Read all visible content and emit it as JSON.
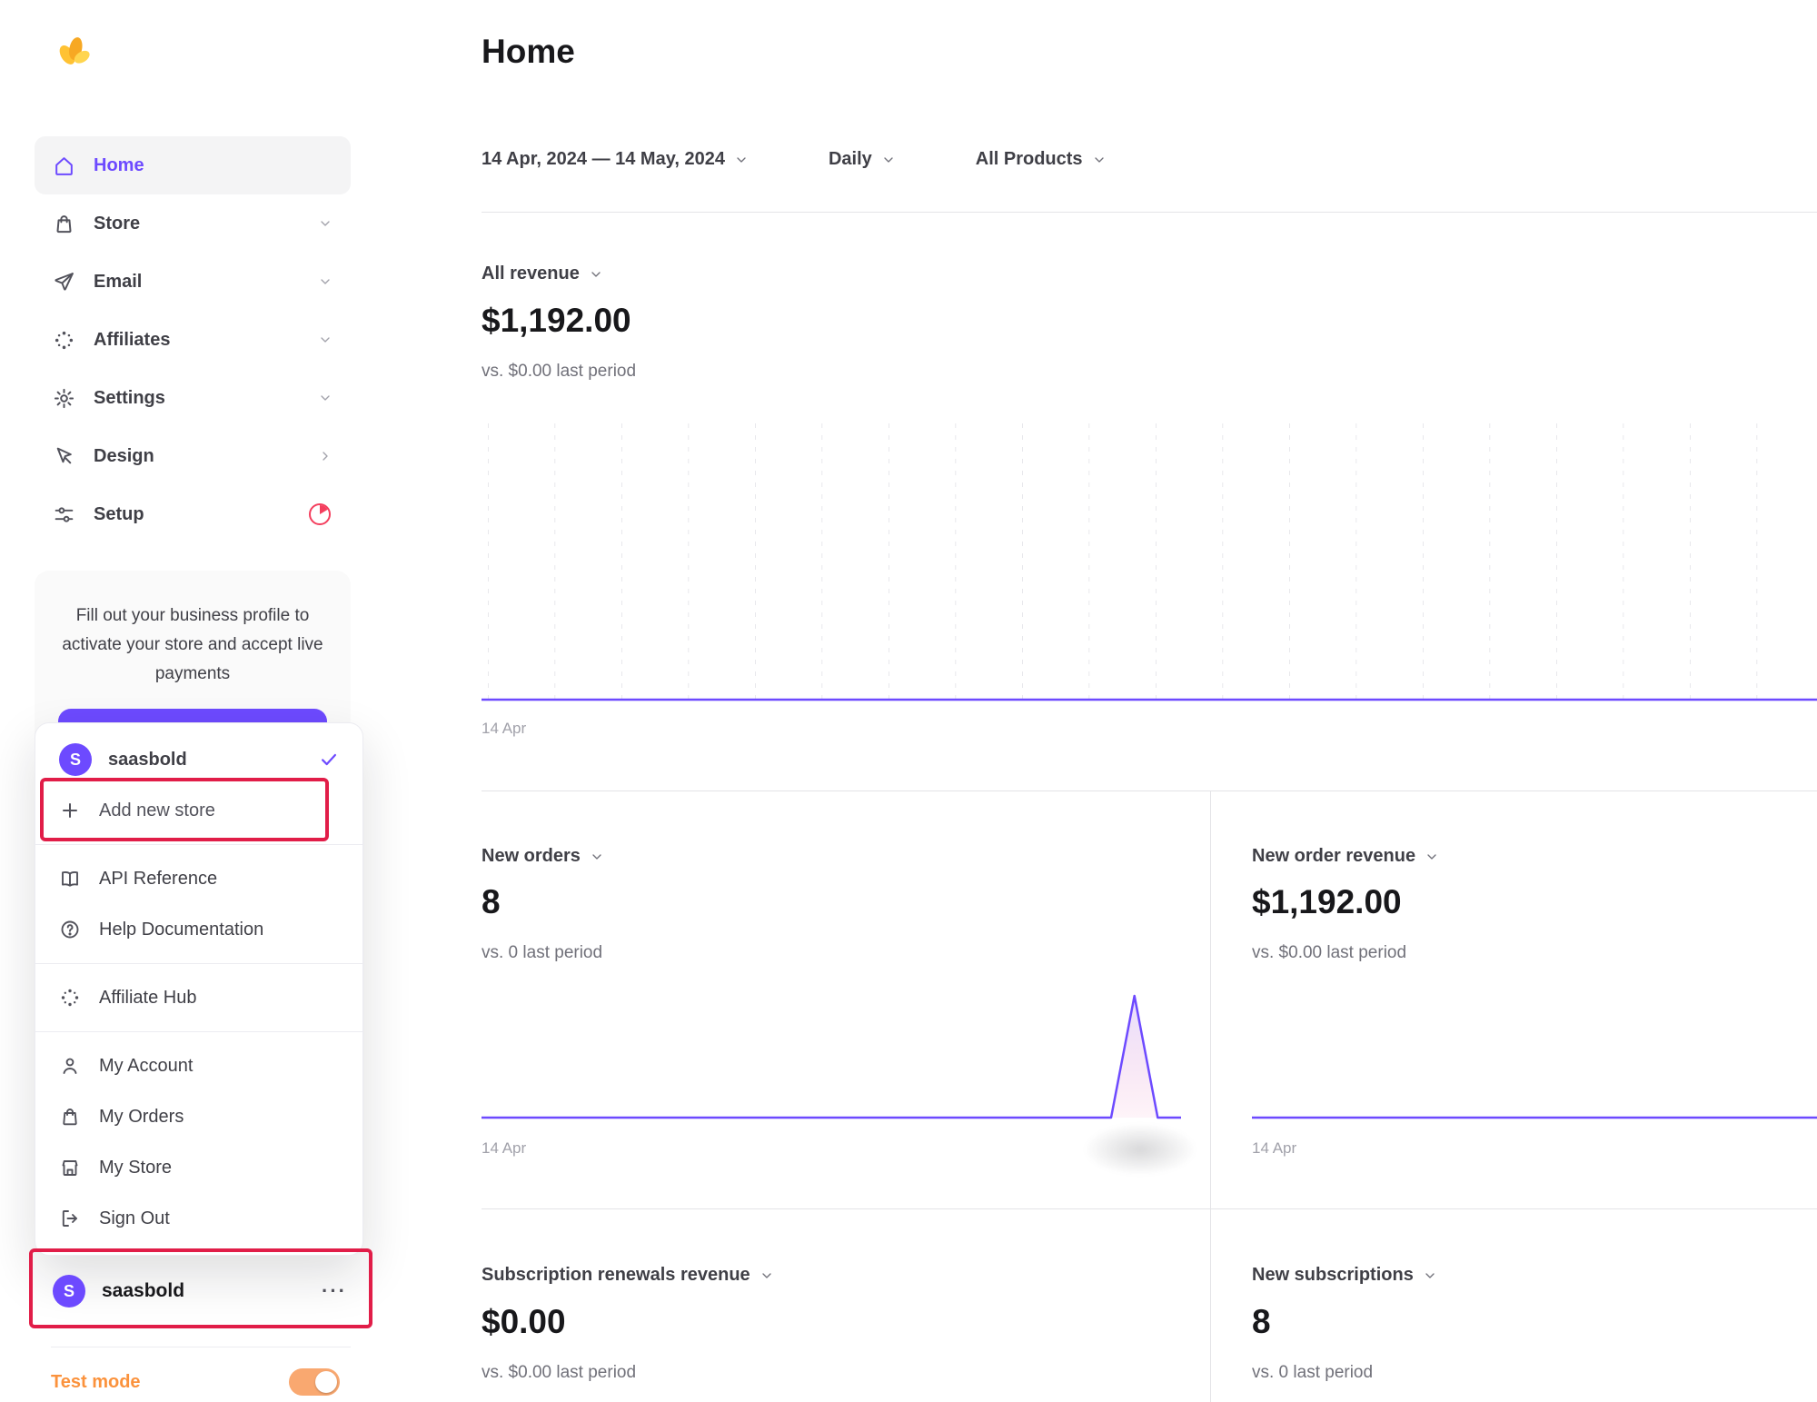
{
  "colors": {
    "accent": "#6d4aff",
    "annotation": "#e11d48",
    "test_mode_orange": "#fb923c",
    "logo_yellow": "#ffc233",
    "setup_badge_pink": "#f43f5e",
    "chart_line": "#6d4aff",
    "grid_line": "#dfdfe3"
  },
  "sidebar": {
    "nav": [
      {
        "label": "Home",
        "icon": "home-icon",
        "active": true
      },
      {
        "label": "Store",
        "icon": "store-bag-icon",
        "chevron": "down"
      },
      {
        "label": "Email",
        "icon": "send-icon",
        "chevron": "down"
      },
      {
        "label": "Affiliates",
        "icon": "affiliates-dots-icon",
        "chevron": "down"
      },
      {
        "label": "Settings",
        "icon": "gear-icon",
        "chevron": "down"
      },
      {
        "label": "Design",
        "icon": "cursor-icon",
        "chevron": "right"
      },
      {
        "label": "Setup",
        "icon": "sliders-icon",
        "badge": "pie-progress-icon"
      }
    ],
    "business_card": {
      "text": "Fill out your business profile to activate your store and accept live payments"
    },
    "store_row": {
      "name": "saasbold",
      "avatar_letter": "S",
      "more": "···"
    },
    "test_mode_label": "Test mode",
    "test_mode_on": true
  },
  "popover": {
    "store_name": "saasbold",
    "avatar_letter": "S",
    "items": {
      "add_new_store": "Add new store",
      "api_reference": "API Reference",
      "help_documentation": "Help Documentation",
      "affiliate_hub": "Affiliate Hub",
      "my_account": "My Account",
      "my_orders": "My Orders",
      "my_store": "My Store",
      "sign_out": "Sign Out"
    }
  },
  "main": {
    "title": "Home",
    "filters": {
      "date_range": "14 Apr, 2024 — 14 May, 2024",
      "granularity": "Daily",
      "products": "All Products"
    },
    "cards": {
      "all_revenue": {
        "label": "All revenue",
        "value": "$1,192.00",
        "comparison": "vs. $0.00 last period",
        "x_label": "14 Apr"
      },
      "new_orders": {
        "label": "New orders",
        "value": "8",
        "comparison": "vs. 0 last period",
        "x_label": "14 Apr"
      },
      "new_order_revenue": {
        "label": "New order revenue",
        "value": "$1,192.00",
        "comparison": "vs. $0.00 last period",
        "x_label": "14 Apr"
      },
      "subscription_renewals_revenue": {
        "label": "Subscription renewals revenue",
        "value": "$0.00",
        "comparison": "vs. $0.00 last period"
      },
      "new_subscriptions": {
        "label": "New subscriptions",
        "value": "8",
        "comparison": "vs. 0 last period"
      }
    }
  },
  "chart_data": [
    {
      "type": "line",
      "name": "All revenue",
      "title": "$1,192.00",
      "comparison": "vs. $0.00 last period",
      "granularity": "Daily",
      "x_start": "14 Apr 2024",
      "x_end": "14 May 2024",
      "visible_x_ticks": [
        "14 Apr"
      ],
      "grid": "vertical-dashed",
      "values": [
        0,
        0,
        0,
        0,
        0,
        0,
        0,
        0,
        0,
        0,
        0,
        0,
        0,
        0,
        0,
        0,
        0,
        0,
        0,
        0,
        0,
        0,
        0,
        0,
        0,
        0,
        0,
        0,
        0,
        0,
        0
      ],
      "note": "line flat at baseline for all visible days"
    },
    {
      "type": "line",
      "name": "New orders",
      "title": "8",
      "comparison": "vs. 0 last period",
      "granularity": "Daily",
      "x_start": "14 Apr 2024",
      "x_end": "14 May 2024",
      "visible_x_ticks": [
        "14 Apr"
      ],
      "grid": "off",
      "values": [
        0,
        0,
        0,
        0,
        0,
        0,
        0,
        0,
        0,
        0,
        0,
        0,
        0,
        0,
        0,
        0,
        0,
        0,
        0,
        0,
        0,
        0,
        0,
        0,
        0,
        0,
        0,
        0,
        8,
        0,
        0
      ],
      "note": "flat at 0 with single spike to 8 near 12 May"
    },
    {
      "type": "line",
      "name": "New order revenue",
      "title": "$1,192.00",
      "comparison": "vs. $0.00 last period",
      "granularity": "Daily",
      "x_start": "14 Apr 2024",
      "x_end": "14 May 2024",
      "visible_x_ticks": [
        "14 Apr"
      ],
      "grid": "off",
      "values": [
        0,
        0,
        0,
        0,
        0,
        0,
        0,
        0,
        0,
        0,
        0,
        0,
        0,
        0,
        0,
        0,
        0,
        0,
        0,
        0,
        0,
        0,
        0,
        0,
        0,
        0,
        0,
        0,
        0,
        0,
        0
      ],
      "note": "line appears flat at baseline in visible area"
    }
  ]
}
